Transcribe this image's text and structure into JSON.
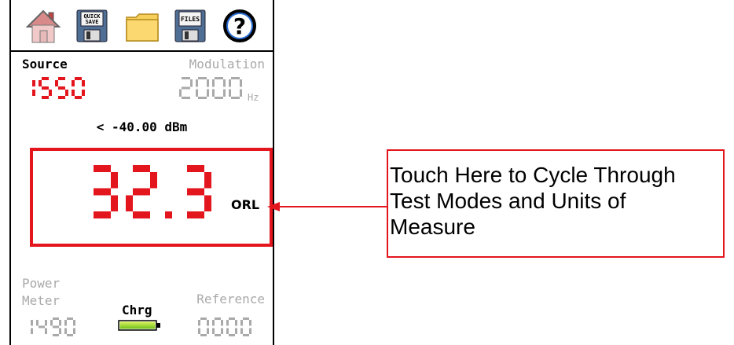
{
  "toolbar": {
    "icons": [
      "home-icon",
      "quick-save-icon",
      "folder-icon",
      "files-icon",
      "help-icon"
    ],
    "quick_save_label_1": "QUICK",
    "quick_save_label_2": "SAVE",
    "files_label": "FILES",
    "help_label": "?"
  },
  "source": {
    "label": "Source",
    "value": "1550",
    "color": "#e3151d"
  },
  "modulation": {
    "label": "Modulation",
    "value": "2000",
    "unit": "Hz",
    "color": "#a9a9a9"
  },
  "power_reading": "< -40.00 dBm",
  "main_display": {
    "value": "32.3",
    "mode": "ORL",
    "color": "#e3151d"
  },
  "power_meter": {
    "label_line1": "Power",
    "label_line2": "Meter",
    "value": "1490"
  },
  "charge": {
    "label": "Chrg",
    "level": 1.0
  },
  "reference": {
    "label": "Reference",
    "value": "0000"
  },
  "callout": {
    "text": "Touch Here to Cycle Through Test Modes and Units of Measure"
  },
  "colors": {
    "accent": "#e3151d",
    "inactive": "#a9a9a9",
    "battery": "#a8e02a"
  }
}
